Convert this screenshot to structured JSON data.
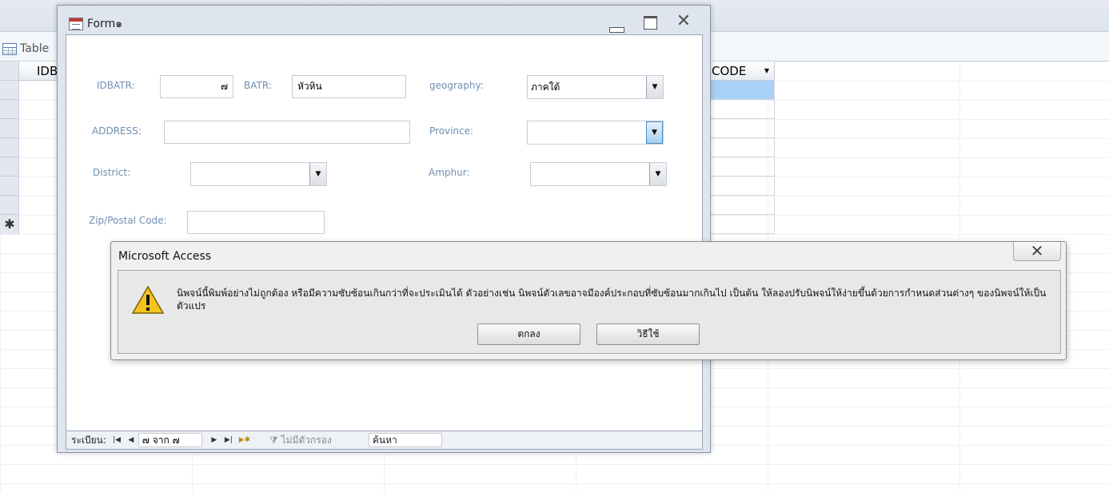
{
  "background": {
    "tab_label": "Table",
    "col_id_header": "IDB",
    "col_code_header": "CODE",
    "new_row_marker": "✱"
  },
  "form": {
    "title": "Form๑",
    "fields": {
      "idbatr_label": "IDBATR:",
      "idbatr_value": "๗",
      "batr_label": "BATR:",
      "batr_value": "หัวหิน",
      "geography_label": "geography:",
      "geography_value": "ภาคใต้",
      "address_label": "ADDRESS:",
      "address_value": "",
      "province_label": "Province:",
      "province_value": "",
      "district_label": "District:",
      "district_value": "",
      "amphur_label": "Amphur:",
      "amphur_value": "",
      "zip_label": "Zip/Postal Code:",
      "zip_value": ""
    },
    "nav": {
      "record_label": "ระเบียน:",
      "position": "๗ จาก ๗",
      "filter_label": "ไม่มีตัวกรอง",
      "search_value": "ค้นหา"
    }
  },
  "dialog": {
    "title": "Microsoft Access",
    "message": "นิพจน์นี้พิมพ์อย่างไม่ถูกต้อง หรือมีความซับซ้อนเกินกว่าที่จะประเมินได้ ตัวอย่างเช่น นิพจน์ตัวเลขอาจมีองค์ประกอบที่ซับซ้อนมากเกินไป เป็นต้น ให้ลองปรับนิพจน์ให้ง่ายขึ้นด้วยการกำหนดส่วนต่างๆ ของนิพจน์ให้เป็นตัวแปร",
    "ok_label": "ตกลง",
    "help_label": "วิธีใช้"
  }
}
